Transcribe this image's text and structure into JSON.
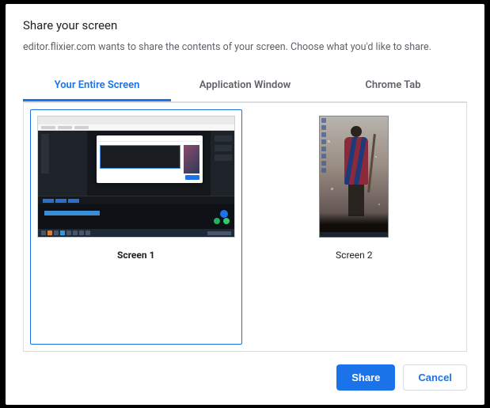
{
  "dialog": {
    "title": "Share your screen",
    "subtitle": "editor.flixier.com wants to share the contents of your screen. Choose what you'd like to share."
  },
  "tabs": {
    "entire_screen": "Your Entire Screen",
    "app_window": "Application Window",
    "chrome_tab": "Chrome Tab",
    "active": "entire_screen"
  },
  "screens": [
    {
      "label": "Screen 1",
      "selected": true
    },
    {
      "label": "Screen 2",
      "selected": false
    }
  ],
  "buttons": {
    "share": "Share",
    "cancel": "Cancel"
  },
  "colors": {
    "accent": "#1a73e8",
    "text": "#202124",
    "muted": "#5f6368",
    "border": "#dadce0"
  }
}
